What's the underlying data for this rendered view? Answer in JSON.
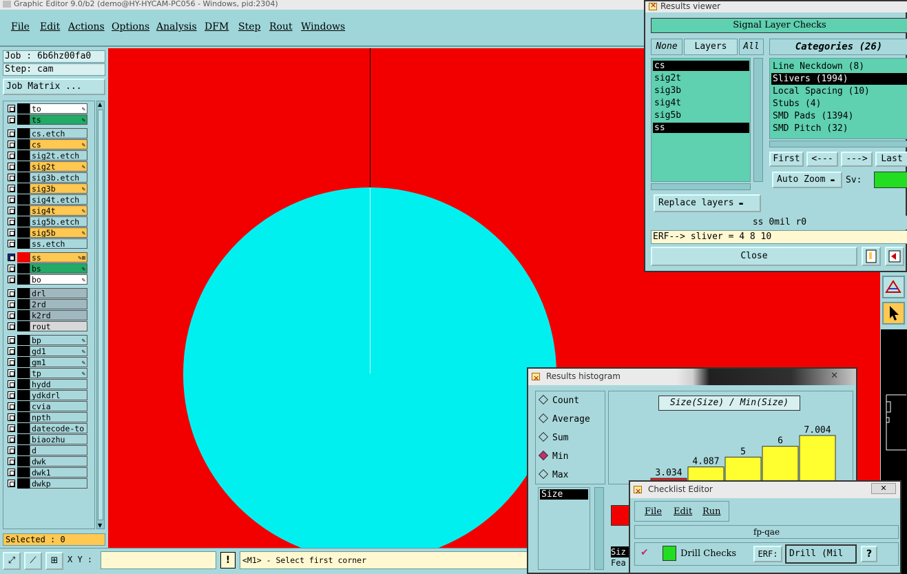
{
  "main": {
    "title": "Graphic Editor 9.0/b2 (demo@HY-HYCAM-PC056 - Windows, pid:2304)",
    "menu": [
      "File",
      "Edit",
      "Actions",
      "Options",
      "Analysis",
      "DFM",
      "Step",
      "Rout",
      "Windows"
    ],
    "job": "Job : 6b6hz00fa0",
    "step": "Step: cam",
    "job_matrix": "Job Matrix ...",
    "selected": "Selected : 0",
    "xy_label": "X Y :",
    "xy_value": "",
    "help": "!",
    "prompt": "<M1> - Select first corner"
  },
  "layers": [
    {
      "name": "to",
      "color": "#ffffff",
      "flag": "✎"
    },
    {
      "name": "ts",
      "color": "#22aa66",
      "flag": "✎"
    },
    {
      "name": "cs.etch",
      "color": "#a8d8dc",
      "flag": ""
    },
    {
      "name": "cs",
      "color": "#ffc850",
      "flag": "✎"
    },
    {
      "name": "sig2t.etch",
      "color": "#a8d8dc",
      "flag": ""
    },
    {
      "name": "sig2t",
      "color": "#ffc850",
      "flag": "✎"
    },
    {
      "name": "sig3b.etch",
      "color": "#a8d8dc",
      "flag": ""
    },
    {
      "name": "sig3b",
      "color": "#ffc850",
      "flag": "✎"
    },
    {
      "name": "sig4t.etch",
      "color": "#a8d8dc",
      "flag": ""
    },
    {
      "name": "sig4t",
      "color": "#ffc850",
      "flag": "✎"
    },
    {
      "name": "sig5b.etch",
      "color": "#a8d8dc",
      "flag": ""
    },
    {
      "name": "sig5b",
      "color": "#ffc850",
      "flag": "✎"
    },
    {
      "name": "ss.etch",
      "color": "#a8d8dc",
      "flag": ""
    },
    {
      "name": "ss",
      "color": "#ffc850",
      "flag": "✎⊞"
    },
    {
      "name": "bs",
      "color": "#22aa66",
      "flag": "✎"
    },
    {
      "name": "bo",
      "color": "#ffffff",
      "flag": "✎"
    },
    {
      "name": "drl",
      "color": "#a0b8c0",
      "flag": ""
    },
    {
      "name": "2rd",
      "color": "#a0b8c0",
      "flag": ""
    },
    {
      "name": "k2rd",
      "color": "#a0b8c0",
      "flag": ""
    },
    {
      "name": "rout",
      "color": "#d8d8d8",
      "flag": ""
    },
    {
      "name": "bp",
      "color": "#a8d8dc",
      "flag": "✎"
    },
    {
      "name": "gd1",
      "color": "#a8d8dc",
      "flag": "✎"
    },
    {
      "name": "gm1",
      "color": "#a8d8dc",
      "flag": "✎"
    },
    {
      "name": "tp",
      "color": "#a8d8dc",
      "flag": "✎"
    },
    {
      "name": "hydd",
      "color": "#a8d8dc",
      "flag": ""
    },
    {
      "name": "ydkdrl",
      "color": "#a8d8dc",
      "flag": ""
    },
    {
      "name": "cvia",
      "color": "#a8d8dc",
      "flag": ""
    },
    {
      "name": "npth",
      "color": "#a8d8dc",
      "flag": ""
    },
    {
      "name": "datecode-to",
      "color": "#a8d8dc",
      "flag": ""
    },
    {
      "name": "biaozhu",
      "color": "#a8d8dc",
      "flag": ""
    },
    {
      "name": "d",
      "color": "#a8d8dc",
      "flag": ""
    },
    {
      "name": "dwk",
      "color": "#a8d8dc",
      "flag": ""
    },
    {
      "name": "dwk1",
      "color": "#a8d8dc",
      "flag": ""
    },
    {
      "name": "dwkp",
      "color": "#a8d8dc",
      "flag": ""
    }
  ],
  "results_viewer": {
    "title": "Results viewer",
    "header": "Signal Layer Checks",
    "tab_none": "None",
    "tab_layers": "Layers",
    "tab_all": "All",
    "categories_header": "Categories (26)",
    "layers": [
      "cs",
      "sig2t",
      "sig3b",
      "sig4t",
      "sig5b",
      "ss"
    ],
    "categories": [
      "Line Neckdown (8)",
      "Slivers (1994)",
      "Local Spacing (10)",
      "Stubs (4)",
      "SMD Pads (1394)",
      "SMD Pitch (32)"
    ],
    "first": "First",
    "prev": "<---",
    "next": "--->",
    "last": "Last",
    "auto_zoom": "Auto Zoom",
    "sv_label": "Sv:",
    "replace_layers": "Replace layers",
    "status": "ss 0mil  r0",
    "erf": "ERF--> sliver = 4 8 10",
    "close": "Close"
  },
  "histogram": {
    "title": "Results histogram",
    "options": [
      "Count",
      "Average",
      "Sum",
      "Min",
      "Max"
    ],
    "selected_option": "Min",
    "list_item": "Size",
    "chart_title": "Size(Size) / Min(Size)",
    "bottom_label_1": "Siz",
    "bottom_label_2": "Fea"
  },
  "chart_data": {
    "type": "bar",
    "title": "Size(Size) / Min(Size)",
    "values": [
      3.034,
      4.087,
      5,
      6,
      7.004
    ],
    "labels": [
      "3.034",
      "4.087",
      "5",
      "6",
      "7.004"
    ],
    "colors": [
      "#e02020",
      "#ffff30",
      "#ffff30",
      "#ffff30",
      "#ffff30"
    ],
    "ylim": [
      0,
      7.004
    ]
  },
  "checklist_editor": {
    "title": "Checklist Editor",
    "menu": [
      "File",
      "Edit",
      "Run"
    ],
    "name": "fp-qae",
    "check_label": "Drill Checks",
    "erf_button": "ERF:",
    "erf_value": "Drill (Mil",
    "help": "?"
  },
  "colors": {
    "canvas": "#f20000",
    "pad": "#00f0f0",
    "panel": "#a8d8dc",
    "highlight": "#ffc850"
  }
}
